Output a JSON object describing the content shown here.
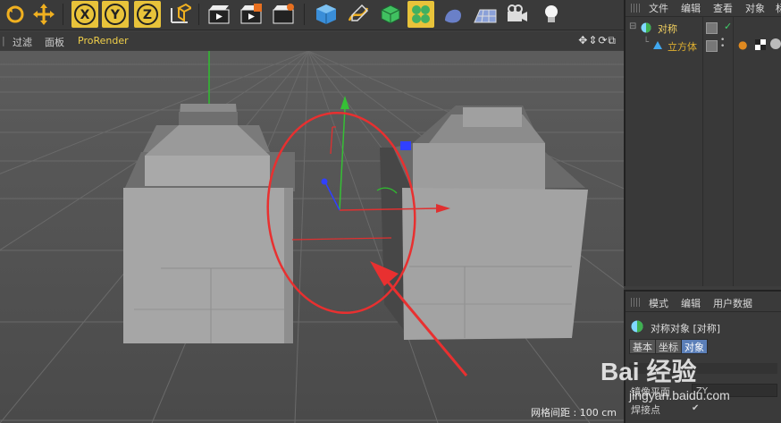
{
  "toolbar": {
    "tools": [
      {
        "icon": "rotate-icon"
      },
      {
        "icon": "move-icon"
      },
      {
        "icon": "x-axis-lock-icon",
        "label": "X"
      },
      {
        "icon": "y-axis-lock-icon",
        "label": "Y"
      },
      {
        "icon": "z-axis-lock-icon",
        "label": "Z"
      },
      {
        "icon": "coordinate-system-icon"
      },
      {
        "icon": "render-view-icon"
      },
      {
        "icon": "render-to-picture-viewer-icon"
      },
      {
        "icon": "render-settings-icon"
      },
      {
        "icon": "cube-icon"
      },
      {
        "icon": "pen-spline-icon"
      },
      {
        "icon": "subdivision-surface-icon"
      },
      {
        "icon": "cloner-icon"
      },
      {
        "icon": "deformer-icon"
      },
      {
        "icon": "floor-icon"
      },
      {
        "icon": "camera-icon"
      },
      {
        "icon": "light-icon"
      }
    ]
  },
  "viewport": {
    "menu": [
      "过滤",
      "面板",
      "ProRender"
    ],
    "nav_icons": "✥⇕⟳⧉",
    "grid_spacing": "网格间距 : 100 cm"
  },
  "object_manager": {
    "menu": [
      "文件",
      "编辑",
      "查看",
      "对象",
      "标"
    ],
    "objects": [
      {
        "name": "对称",
        "type": "symmetry",
        "color": "#7fd8ff"
      },
      {
        "name": "立方体",
        "type": "cube",
        "color": "#e0b030"
      }
    ]
  },
  "attributes": {
    "menu": [
      "模式",
      "编辑",
      "用户数据"
    ],
    "object_title": "对称对象 [对称]",
    "tabs": [
      "基本",
      "坐标",
      "对象"
    ],
    "active_tab": "对象",
    "properties": [
      {
        "label": "镜像平面",
        "value": "ZY"
      },
      {
        "label": "焊接点",
        "value": "✔"
      }
    ]
  },
  "watermark": {
    "line1": "Bai 经验",
    "line2": "jingyan.baidu.com"
  },
  "colors": {
    "accent": "#e8c33a",
    "axis_x": "#e03030",
    "axis_y": "#30c030",
    "axis_z": "#3050ff",
    "annotation": "#e83030"
  }
}
